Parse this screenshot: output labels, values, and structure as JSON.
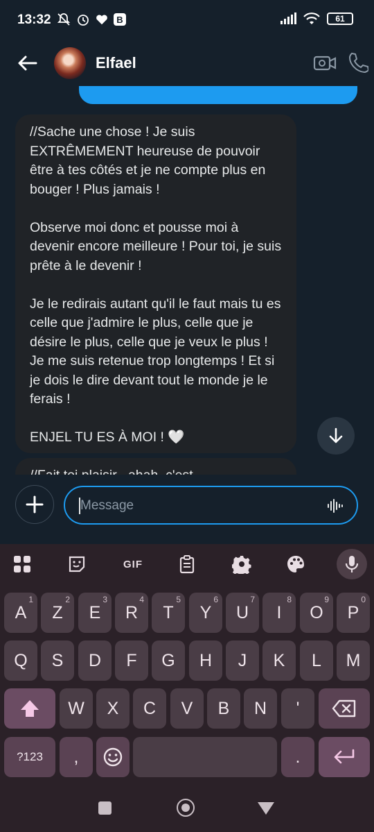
{
  "status_bar": {
    "time": "13:32",
    "battery": "61",
    "badge": "B"
  },
  "header": {
    "contact_name": "Elfael"
  },
  "messages": {
    "received_1_paragraphs": [
      "//Sache une chose ! Je suis EXTRÊMEMENT heureuse de pouvoir être à tes côtés et je ne compte plus en bouger ! Plus jamais !",
      "Observe moi donc et pousse moi à devenir encore meilleure ! Pour toi, je suis prête à le devenir !",
      "Je le redirais autant qu'il le faut mais tu es celle que j'admire le plus, celle que je désire le plus, celle que je veux le plus ! Je me suis retenue trop longtemps ! Et si je dois le dire devant tout le monde je le ferais !",
      "ENJEL TU ES À MOI ! 🤍"
    ],
    "received_2_peek": "//Fait toi plaisir , ahah, c'est"
  },
  "composer": {
    "placeholder": "Message"
  },
  "keyboard": {
    "toolbar": {
      "gif_label": "GIF"
    },
    "row1": [
      {
        "label": "A",
        "sup": "1"
      },
      {
        "label": "Z",
        "sup": "2"
      },
      {
        "label": "E",
        "sup": "3"
      },
      {
        "label": "R",
        "sup": "4"
      },
      {
        "label": "T",
        "sup": "5"
      },
      {
        "label": "Y",
        "sup": "6"
      },
      {
        "label": "U",
        "sup": "7"
      },
      {
        "label": "I",
        "sup": "8"
      },
      {
        "label": "O",
        "sup": "9"
      },
      {
        "label": "P",
        "sup": "0"
      }
    ],
    "row2": [
      "Q",
      "S",
      "D",
      "F",
      "G",
      "H",
      "J",
      "K",
      "L",
      "M"
    ],
    "row3": [
      "W",
      "X",
      "C",
      "V",
      "B",
      "N",
      "'"
    ],
    "row4": {
      "symbols": "?123",
      "comma": ",",
      "period": "."
    }
  },
  "colors": {
    "accent": "#1d9bf0",
    "background": "#15202b",
    "bubble_received": "#202327",
    "keyboard_bg": "#2b2128"
  }
}
